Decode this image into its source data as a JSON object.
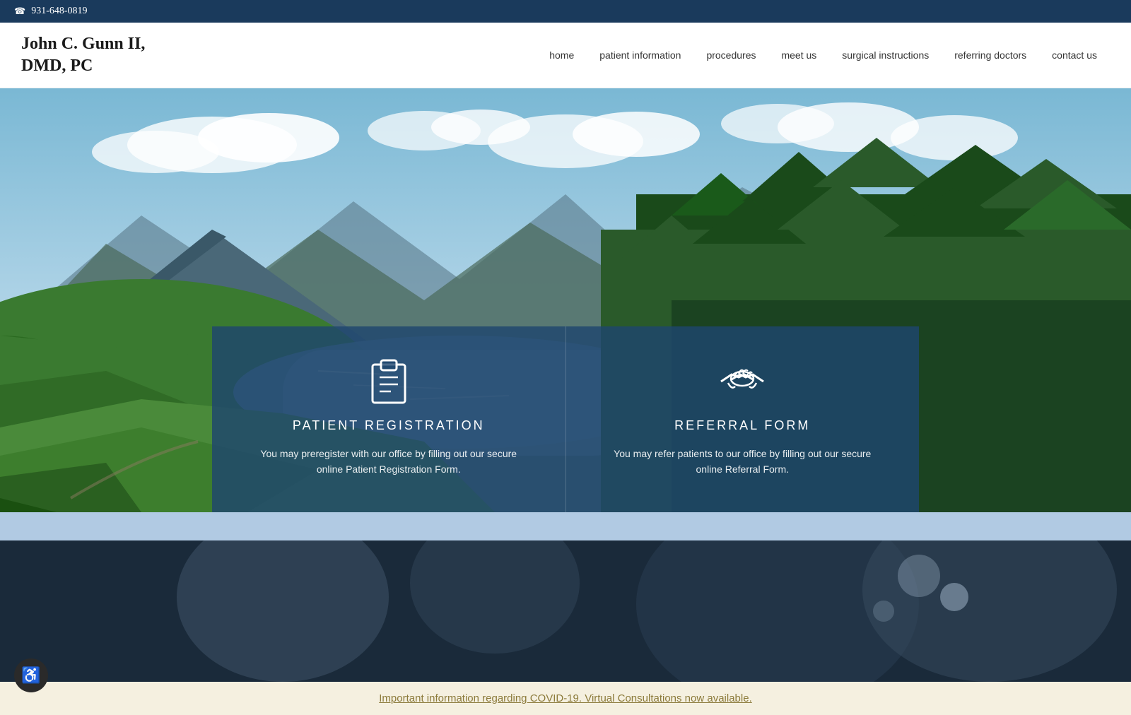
{
  "topbar": {
    "phone": "931-648-0819"
  },
  "header": {
    "logo_line1": "John C. Gunn II,",
    "logo_line2": "DMD, PC",
    "nav": [
      {
        "label": "home",
        "id": "nav-home"
      },
      {
        "label": "patient information",
        "id": "nav-patient-info"
      },
      {
        "label": "procedures",
        "id": "nav-procedures"
      },
      {
        "label": "meet us",
        "id": "nav-meet-us"
      },
      {
        "label": "surgical instructions",
        "id": "nav-surgical"
      },
      {
        "label": "referring doctors",
        "id": "nav-referring"
      },
      {
        "label": "contact us",
        "id": "nav-contact"
      }
    ]
  },
  "cards": [
    {
      "id": "patient-registration",
      "title": "PATIENT REGISTRATION",
      "description": "You may preregister with our office by filling out our secure online Patient Registration Form.",
      "icon": "clipboard"
    },
    {
      "id": "referral-form",
      "title": "REFERRAL FORM",
      "description": "You may refer patients to our office by filling out our secure online Referral Form.",
      "icon": "handshake"
    }
  ],
  "covid_banner": {
    "text": "Important information regarding COVID-19. Virtual Consultations now available."
  },
  "accessibility": {
    "label": "Accessibility"
  }
}
